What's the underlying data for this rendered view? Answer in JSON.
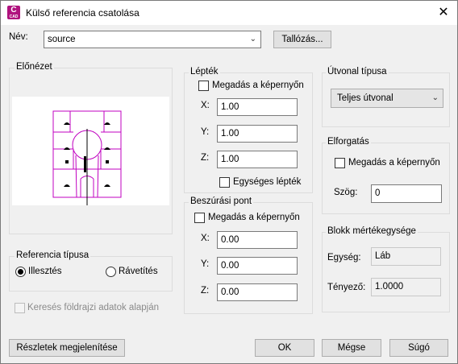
{
  "window": {
    "title": "Külső referencia csatolása",
    "app_icon": {
      "letter": "C",
      "sub": "CAD"
    },
    "close_symbol": "✕"
  },
  "name_row": {
    "label": "Név:",
    "value": "source",
    "browse_button": "Tallózás..."
  },
  "preview": {
    "label": "Előnézet"
  },
  "ref_type": {
    "label": "Referencia típusa",
    "options": [
      "Illesztés",
      "Rávetítés"
    ],
    "selected": "Illesztés"
  },
  "geo_search": {
    "label": "Keresés földrajzi adatok alapján",
    "enabled": false,
    "checked": false
  },
  "scale": {
    "label": "Lépték",
    "on_screen": "Megadás a képernyőn",
    "x_label": "X:",
    "x": "1.00",
    "y_label": "Y:",
    "y": "1.00",
    "z_label": "Z:",
    "z": "1.00",
    "uniform": "Egységes lépték"
  },
  "insertion": {
    "label": "Beszúrási pont",
    "on_screen": "Megadás a képernyőn",
    "x_label": "X:",
    "x": "0.00",
    "y_label": "Y:",
    "y": "0.00",
    "z_label": "Z:",
    "z": "0.00"
  },
  "path_type": {
    "label": "Útvonal típusa",
    "value": "Teljes útvonal"
  },
  "rotation": {
    "label": "Elforgatás",
    "on_screen": "Megadás a képernyőn",
    "angle_label": "Szög:",
    "angle": "0"
  },
  "block_unit": {
    "label": "Blokk mértékegysége",
    "unit_label": "Egység:",
    "unit": "Láb",
    "factor_label": "Tényező:",
    "factor": "1.0000"
  },
  "buttons": {
    "details": "Részletek megjelenítése",
    "ok": "OK",
    "cancel": "Mégse",
    "help": "Súgó"
  },
  "colors": {
    "accent": "#b0127e",
    "drawing": "#c000c0"
  }
}
